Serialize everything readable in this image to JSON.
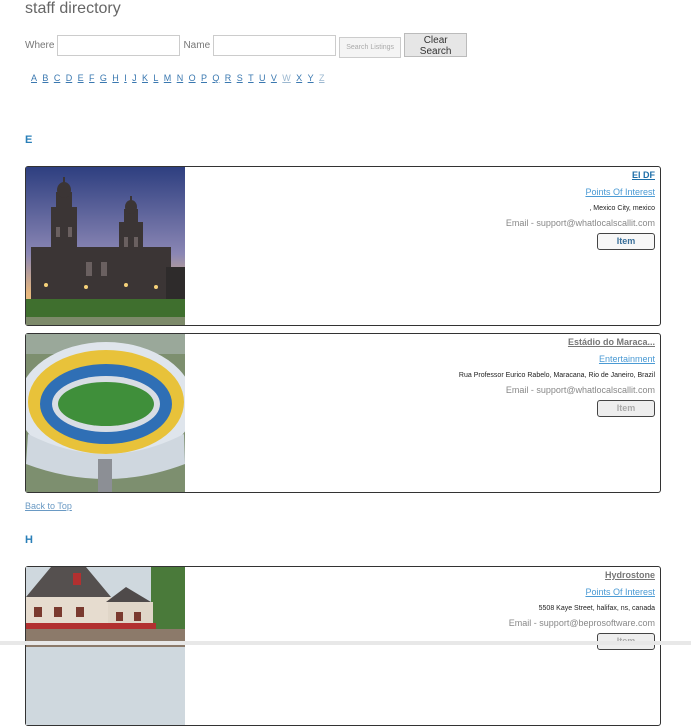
{
  "page": {
    "title": "staff directory"
  },
  "search": {
    "where_label": "Where",
    "name_label": "Name",
    "where_value": "",
    "name_value": "",
    "search_button": "Search Listings",
    "clear_button": "Clear Search"
  },
  "alphabet": [
    "A",
    "B",
    "C",
    "D",
    "E",
    "F",
    "G",
    "H",
    "I",
    "J",
    "K",
    "L",
    "M",
    "N",
    "O",
    "P",
    "Q",
    "R",
    "S",
    "T",
    "U",
    "V",
    "W",
    "X",
    "Y",
    "Z"
  ],
  "sections": [
    {
      "letter": "E"
    },
    {
      "letter": "H"
    }
  ],
  "listings": [
    {
      "name": "El DF",
      "category": "Points Of Interest",
      "address": ", Mexico City, mexico",
      "email": "Email - support@whatlocalscallit.com",
      "button": "Item",
      "photo": "cathedral"
    },
    {
      "name": "Estádio do Maraca...",
      "category": "Entertainment",
      "address": "Rua Professor Eurico Rabelo, Maracana, Rio de Janeiro, Brazil",
      "email": "Email - support@whatlocalscallit.com",
      "button": "Item",
      "photo": "stadium"
    },
    {
      "name": "Hydrostone",
      "category": "Points Of Interest",
      "address": "5508 Kaye Street, halifax, ns, canada",
      "email": "Email - support@beprosoftware.com",
      "button": "Item",
      "photo": "houses"
    }
  ],
  "back_to_top": "Back to Top"
}
